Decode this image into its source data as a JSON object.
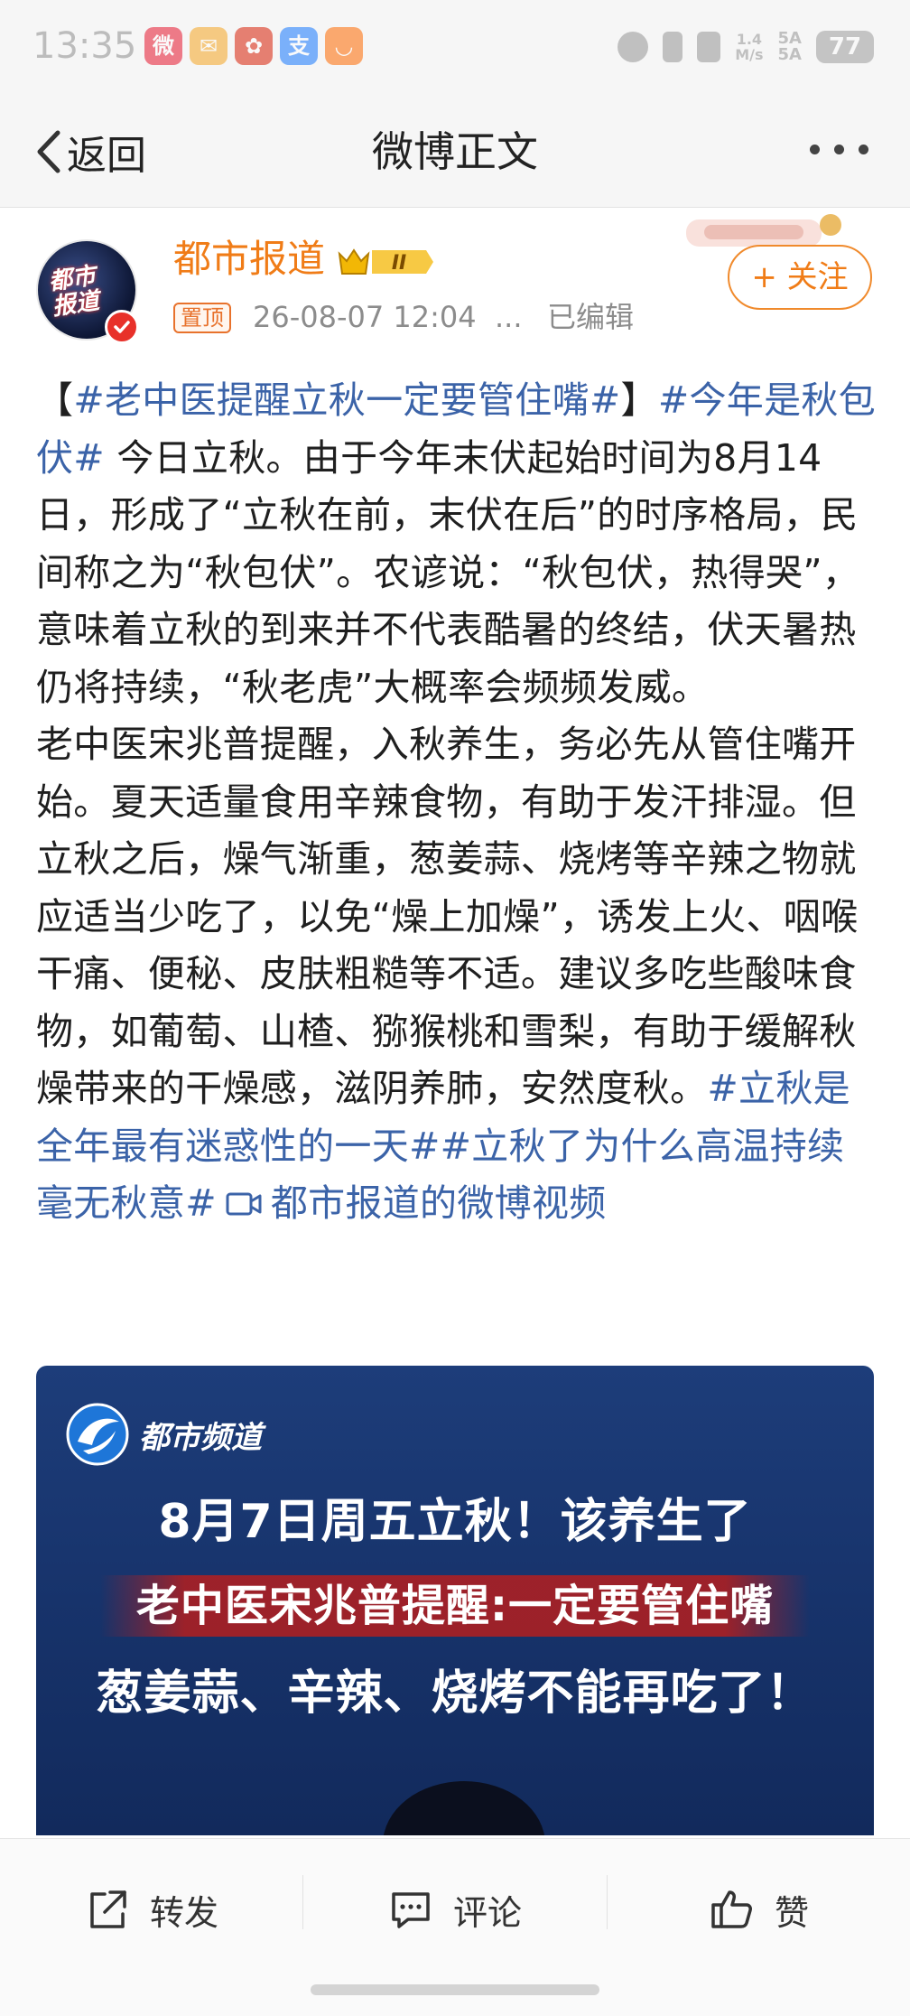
{
  "status_bar": {
    "time": "13:35",
    "apps": [
      {
        "icon": "weibo-icon",
        "glyph": "微",
        "color": "#e6162d"
      },
      {
        "icon": "mail-icon",
        "glyph": "✉",
        "color": "#f5a623"
      },
      {
        "icon": "flower-app-icon",
        "glyph": "✿",
        "color": "#d81e06"
      },
      {
        "icon": "alipay-icon",
        "glyph": "支",
        "color": "#1677ff"
      },
      {
        "icon": "shopping-app-icon",
        "glyph": "◡",
        "color": "#ff6a00"
      }
    ],
    "net_speed": "1.4\nM/s",
    "signal": "5A\n5A",
    "battery": "77"
  },
  "nav": {
    "back_label": "返回",
    "title": "微博正文"
  },
  "author": {
    "name": "都市报道",
    "avatar_text": "都市\n报道",
    "vip_level": "II",
    "pinned_label": "置顶",
    "time": "26-08-07 12:04",
    "ellipsis": "...",
    "edited": "已编辑",
    "follow_label": "+ 关注"
  },
  "post": {
    "bracket_open": "【",
    "tag1": "#老中医提醒立秋一定要管住嘴#",
    "bracket_close": "】",
    "tag2": "#今年是秋包伏#",
    "para1": " 今日立秋。由于今年末伏起始时间为8月14日，形成了“立秋在前，末伏在后”的时序格局，民间称之为“秋包伏”。农谚说：“秋包伏，热得哭”，意味着立秋的到来并不代表酷暑的终结，伏天暑热仍将持续，“秋老虎”大概率会频频发威。",
    "para2": "老中医宋兆普提醒，入秋养生，务必先从管住嘴开始。夏天适量食用辛辣食物，有助于发汗排湿。但立秋之后，燥气渐重，葱姜蒜、烧烤等辛辣之物就应适当少吃了，以免“燥上加燥”，诱发上火、咽喉干痛、便秘、皮肤粗糙等不适。建议多吃些酸味食物，如葡萄、山楂、猕猴桃和雪梨，有助于缓解秋燥带来的干燥感，滋阴养肺，安然度秋。",
    "tag3": "#立秋是全年最有迷惑性的一天#",
    "tag4": "#立秋了为什么高温持续毫无秋意#",
    "video_link": "都市报道的微博视频"
  },
  "video": {
    "channel": "都市频道",
    "line1": "8月7日周五立秋！该养生了",
    "line2": "老中医宋兆普提醒:一定要管住嘴",
    "line3": "葱姜蒜、辛辣、烧烤不能再吃了！"
  },
  "actions": {
    "repost": "转发",
    "comment": "评论",
    "like": "赞"
  },
  "colors": {
    "accent_orange": "#f07c17",
    "link_blue": "#3b63a8",
    "meta_gray": "#8c8c8c"
  }
}
